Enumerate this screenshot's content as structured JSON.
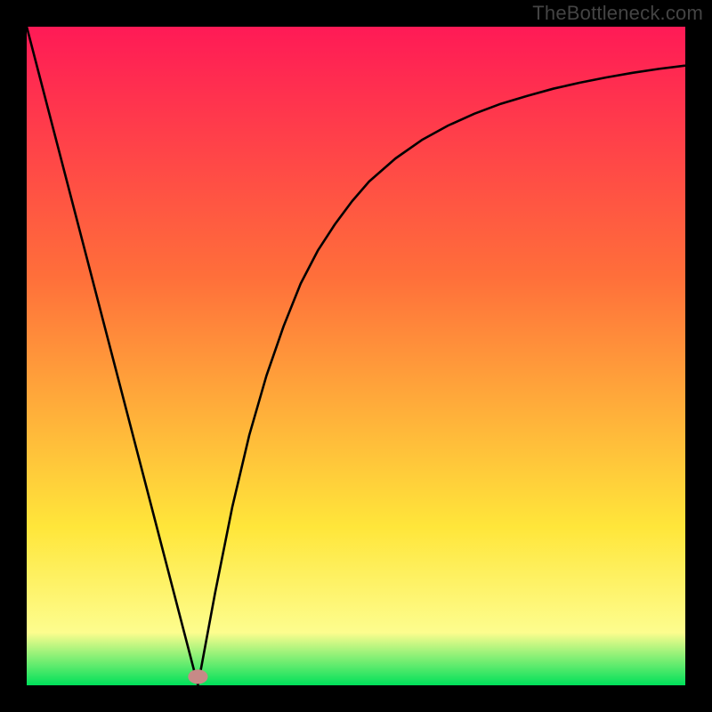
{
  "watermark": "TheBottleneck.com",
  "chart_data": {
    "type": "line",
    "title": "",
    "xlabel": "",
    "ylabel": "",
    "xlim": [
      0,
      1
    ],
    "ylim": [
      0,
      1
    ],
    "grid": false,
    "gradient_colors": {
      "top": "#ff1a56",
      "upper_mid": "#ff6f3a",
      "yellow": "#ffe63a",
      "pale_yellow": "#fdfd8e",
      "green": "#00e05a"
    },
    "marker": {
      "x": 0.26,
      "y": 0.013,
      "color": "#c78a87",
      "rx": 0.015,
      "ry": 0.011
    },
    "series": [
      {
        "name": "curve",
        "color": "#000000",
        "x": [
          0.0,
          0.026,
          0.052,
          0.078,
          0.104,
          0.13,
          0.156,
          0.182,
          0.208,
          0.234,
          0.26,
          0.286,
          0.312,
          0.338,
          0.364,
          0.39,
          0.416,
          0.442,
          0.468,
          0.494,
          0.52,
          0.56,
          0.6,
          0.64,
          0.68,
          0.72,
          0.76,
          0.8,
          0.84,
          0.88,
          0.92,
          0.96,
          1.0
        ],
        "y": [
          1.0,
          0.9,
          0.8,
          0.7,
          0.6,
          0.5,
          0.4,
          0.3,
          0.2,
          0.1,
          0.0,
          0.14,
          0.27,
          0.38,
          0.47,
          0.545,
          0.61,
          0.66,
          0.7,
          0.735,
          0.765,
          0.8,
          0.828,
          0.85,
          0.868,
          0.883,
          0.895,
          0.906,
          0.915,
          0.923,
          0.93,
          0.936,
          0.941
        ]
      }
    ]
  }
}
